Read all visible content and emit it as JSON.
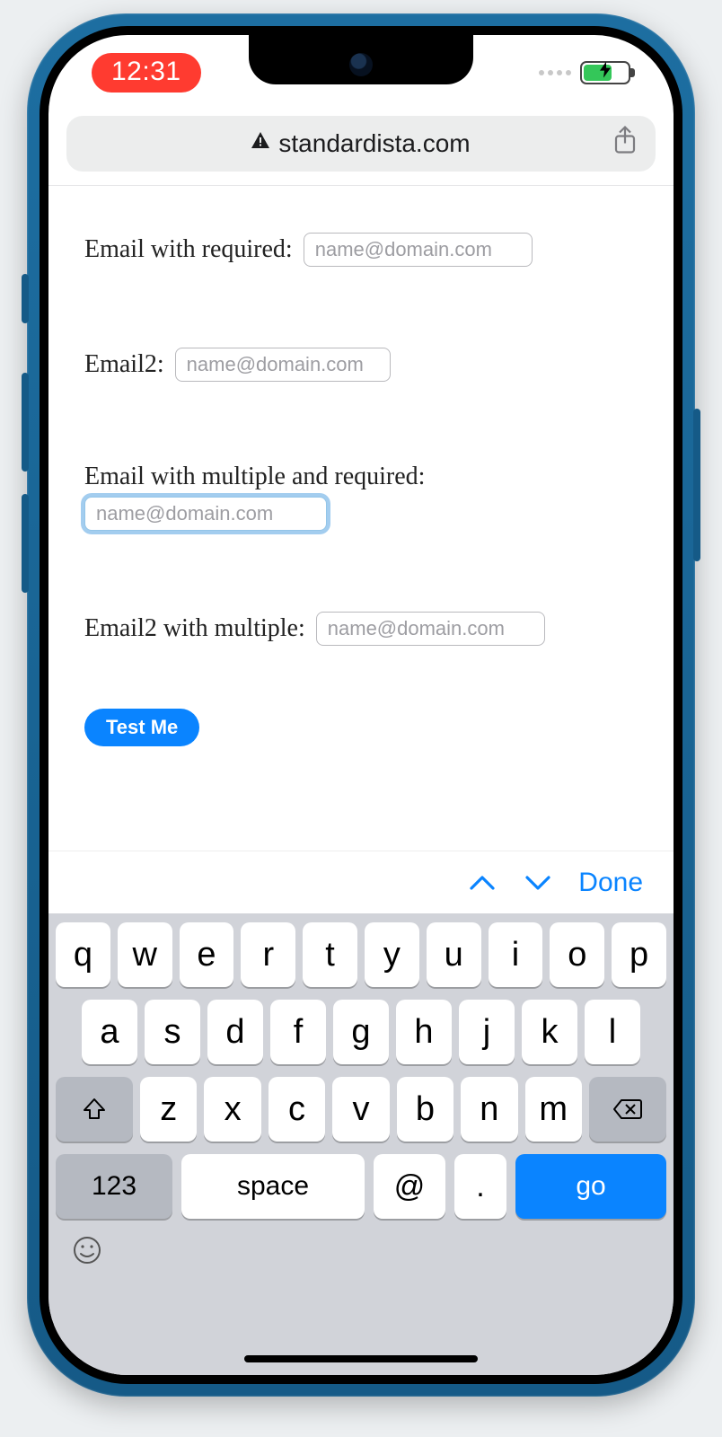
{
  "status": {
    "time": "12:31"
  },
  "browser": {
    "domain": "standardista.com"
  },
  "form": {
    "fields": [
      {
        "label": "Email with required:",
        "placeholder": "name@domain.com"
      },
      {
        "label": "Email2:",
        "placeholder": "name@domain.com"
      },
      {
        "label": "Email with multiple and required:",
        "placeholder": "name@domain.com"
      },
      {
        "label": "Email2 with multiple:",
        "placeholder": "name@domain.com"
      }
    ],
    "submit_label": "Test Me"
  },
  "keyboard_accessory": {
    "done_label": "Done"
  },
  "keyboard": {
    "row1": [
      "q",
      "w",
      "e",
      "r",
      "t",
      "y",
      "u",
      "i",
      "o",
      "p"
    ],
    "row2": [
      "a",
      "s",
      "d",
      "f",
      "g",
      "h",
      "j",
      "k",
      "l"
    ],
    "row3": [
      "z",
      "x",
      "c",
      "v",
      "b",
      "n",
      "m"
    ],
    "numbers_label": "123",
    "space_label": "space",
    "at_label": "@",
    "dot_label": ".",
    "go_label": "go"
  }
}
